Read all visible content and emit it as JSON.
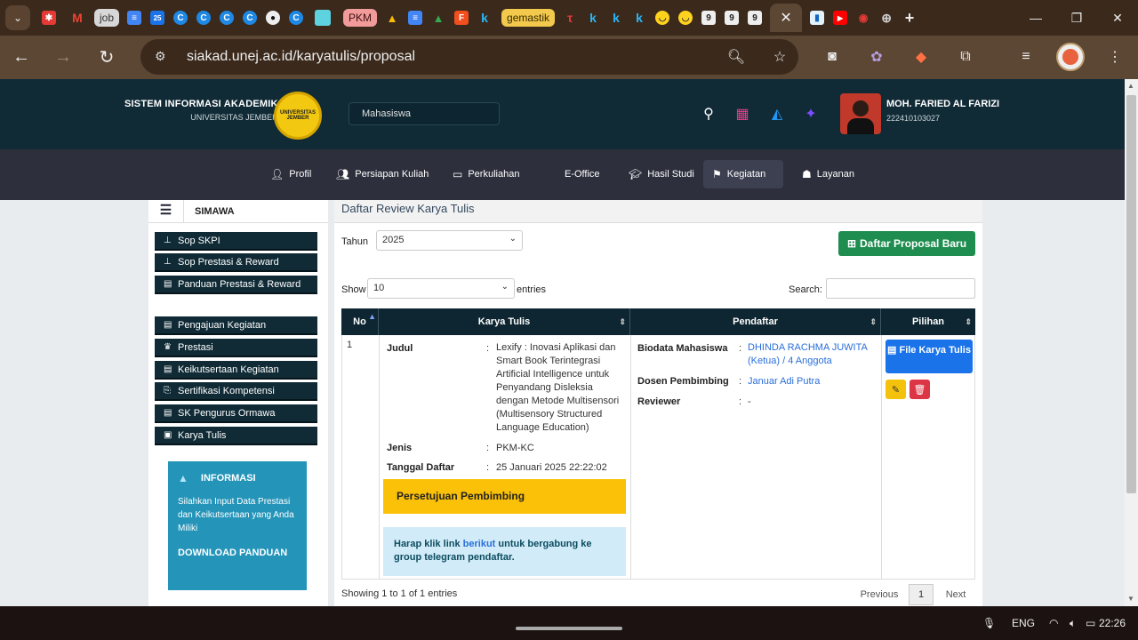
{
  "browser": {
    "tabs_pinned": [
      {
        "icon": "search-tabs-icon"
      },
      {
        "icon": "cross-red-icon"
      },
      {
        "icon": "gmail-icon"
      }
    ],
    "tab_job": "job",
    "tab_pkm": "PKM",
    "tab_gemastik": "gemastik",
    "tab_k": "k",
    "tab_9": "9",
    "active_tab_close": "✕",
    "url": "siakad.unej.ac.id/karyatulis/proposal"
  },
  "header": {
    "title": "SISTEM INFORMASI AKADEMIK",
    "subtitle": "UNIVERSITAS JEMBER",
    "logo_text": "UNIVERSITAS JEMBER",
    "role": "Mahasiswa",
    "user_name": "MOH. FARIED AL FARIZI",
    "user_nim": "222410103027"
  },
  "menu": [
    {
      "label": "Profil",
      "icon": "user-icon"
    },
    {
      "label": "Persiapan Kuliah",
      "icon": "users-icon"
    },
    {
      "label": "Perkuliahan",
      "icon": "chalkboard-icon"
    },
    {
      "label": "E-Office",
      "icon": ""
    },
    {
      "label": "Hasil Studi",
      "icon": "graduate-icon"
    },
    {
      "label": "Kegiatan",
      "icon": "hiking-icon"
    },
    {
      "label": "Layanan",
      "icon": "service-icon"
    }
  ],
  "sidebar": {
    "title": "SIMAWA",
    "group1": [
      "Sop SKPI",
      "Sop Prestasi & Reward",
      "Panduan Prestasi & Reward"
    ],
    "group2": [
      "Pengajuan Kegiatan",
      "Prestasi",
      "Keikutsertaan Kegiatan",
      "Sertifikasi Kompetensi",
      "SK Pengurus Ormawa",
      "Karya Tulis"
    ],
    "info_title": "INFORMASI",
    "info_body": "Silahkan Input Data Prestasi dan Keikutsertaan yang Anda Miliki",
    "info_download": "DOWNLOAD PANDUAN"
  },
  "main": {
    "heading": "Daftar Review Karya Tulis",
    "tahun_label": "Tahun",
    "tahun_value": "2025",
    "new_button": "Daftar Proposal Baru",
    "show_label": "Show",
    "show_value": "10",
    "entries_label": "entries",
    "search_label": "Search:",
    "columns": [
      "No",
      "Karya Tulis",
      "Pendaftar",
      "Pilihan"
    ],
    "row": {
      "no": "1",
      "judul_label": "Judul",
      "judul": "Lexify : Inovasi Aplikasi dan Smart Book Terintegrasi Artificial Intelligence untuk Penyandang Disleksia dengan Metode Multisensori (Multisensory Structured Language Education)",
      "jenis_label": "Jenis",
      "jenis": "PKM-KC",
      "tanggal_label": "Tanggal Daftar",
      "tanggal": "25 Januari 2025 22:22:02",
      "biodata_label": "Biodata Mahasiswa",
      "biodata": "DHINDA RACHMA JUWITA (Ketua) / 4 Anggota",
      "dosen_label": "Dosen Pembimbing",
      "dosen": "Januar Adi Putra",
      "reviewer_label": "Reviewer",
      "reviewer": "-",
      "file_button": "File Karya Tulis",
      "status": "Persetujuan Pembimbing",
      "telegram_pre": "Harap klik link ",
      "telegram_link": "berikut",
      "telegram_post": " untuk bergabung ke group telegram pendaftar."
    },
    "footer_info": "Showing 1 to 1 of 1 entries",
    "prev": "Previous",
    "page": "1",
    "next": "Next"
  },
  "taskbar": {
    "lang": "ENG",
    "time": "22:26"
  }
}
